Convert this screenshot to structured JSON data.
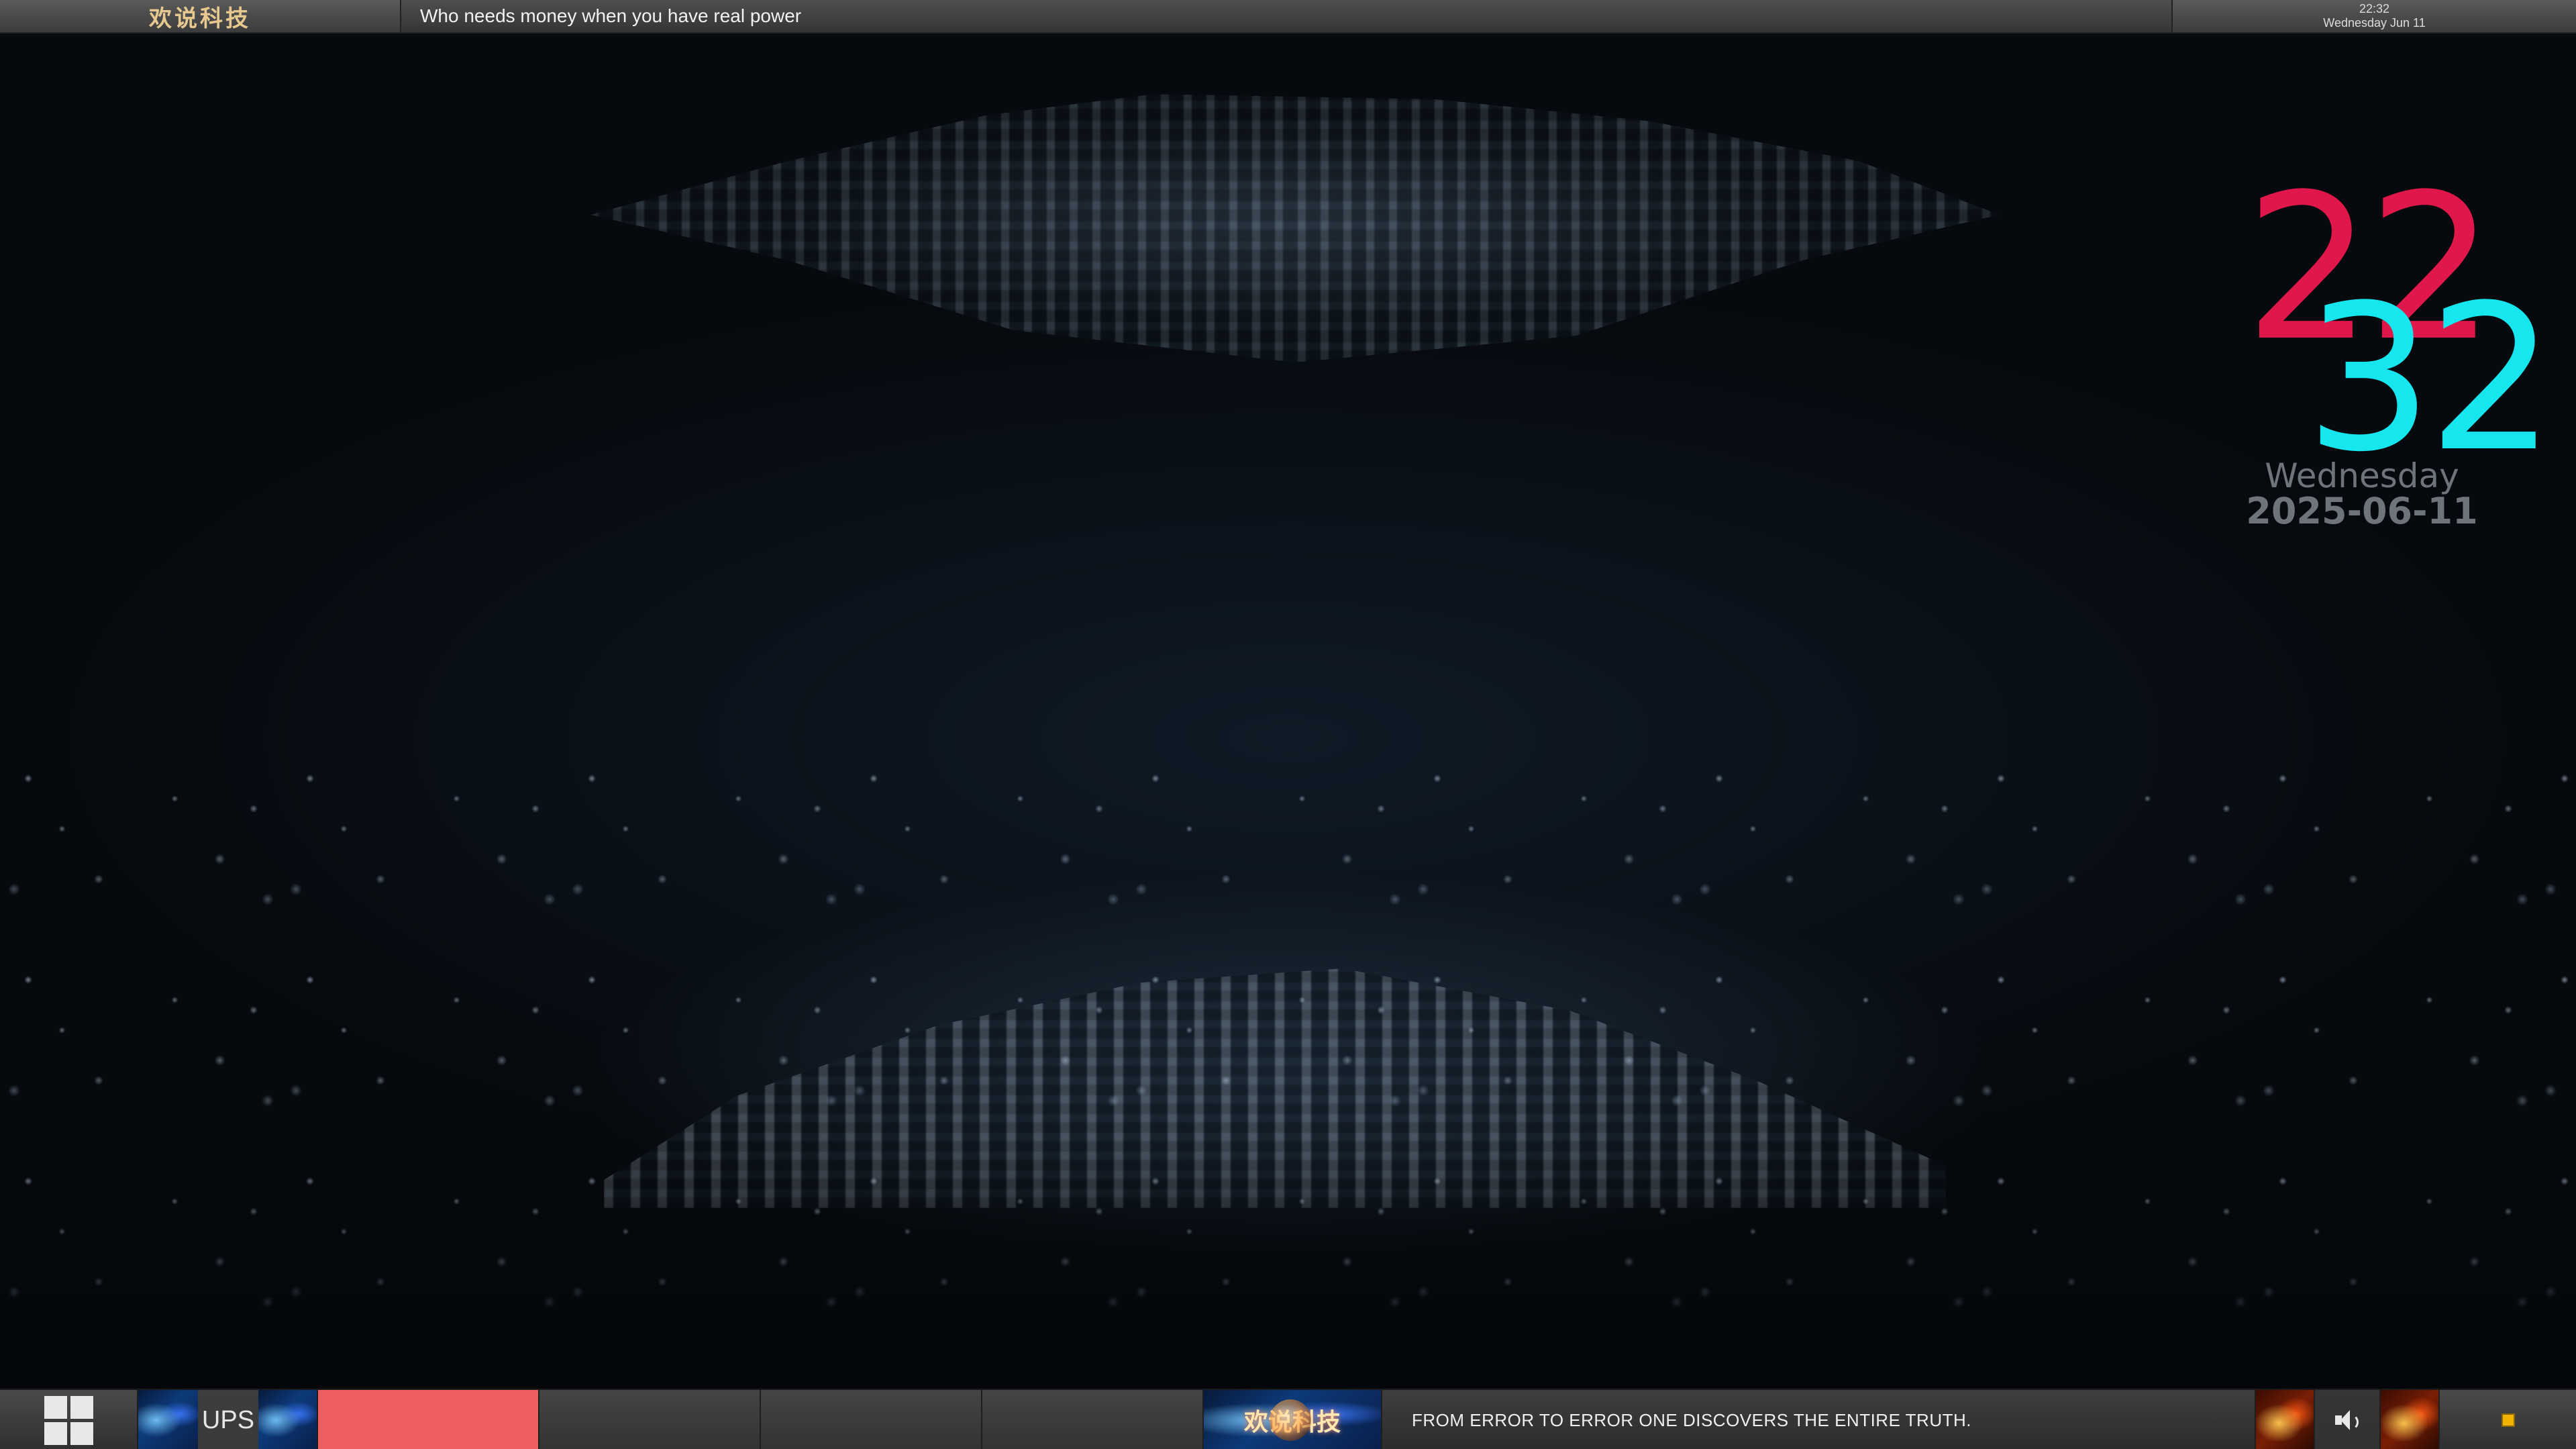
{
  "topbar": {
    "brand": "欢说科技",
    "ticker_text": "Who needs money when you have real power",
    "time": "22:32",
    "date_short": "Wednesday Jun 11"
  },
  "clock": {
    "hours": "22",
    "minutes": "32",
    "weekday": "Wednesday",
    "date": "2025-06-11",
    "colors": {
      "hours": "#e0174a",
      "minutes": "#16e6ee",
      "date": "#6e747b"
    }
  },
  "taskbar": {
    "start_icon": "windows-logo-icon",
    "ups_label": "UPS",
    "meter_color": "#ef5f5f",
    "logo_text": "欢说科技",
    "quote": "FROM ERROR TO ERROR ONE DISCOVERS THE ENTIRE TRUTH.",
    "volume_icon": "speaker-icon",
    "tray_icon": "notification-square-icon"
  }
}
